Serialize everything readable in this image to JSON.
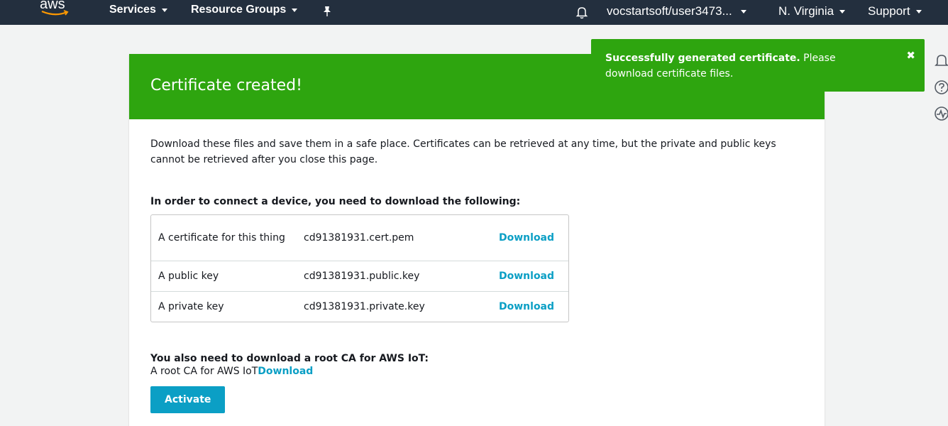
{
  "nav": {
    "logo_text": "aws",
    "services": "Services",
    "resource_groups": "Resource Groups",
    "account": "vocstartsoft/user3473...",
    "region": "N. Virginia",
    "support": "Support"
  },
  "flash": {
    "bold": "Successfully generated certificate.",
    "rest": " Please download certificate files."
  },
  "page": {
    "title": "Certificate created!",
    "intro": "Download these files and save them in a safe place. Certificates can be retrieved at any time, but the private and public keys cannot be retrieved after you close this page.",
    "section_title": "In order to connect a device, you need to download the following:",
    "files": [
      {
        "desc": "A certificate for this thing",
        "file": "cd91381931.cert.pem",
        "link": "Download"
      },
      {
        "desc": "A public key",
        "file": "cd91381931.public.key",
        "link": "Download"
      },
      {
        "desc": "A private key",
        "file": "cd91381931.private.key",
        "link": "Download"
      }
    ],
    "rootca_title": "You also need to download a root CA for AWS IoT:",
    "rootca_label": "A root CA for AWS IoT",
    "rootca_link": "Download",
    "activate": "Activate"
  },
  "colors": {
    "nav_bg": "#232f3e",
    "success_green": "#2ea50f",
    "link_blue": "#0b9fc5"
  }
}
